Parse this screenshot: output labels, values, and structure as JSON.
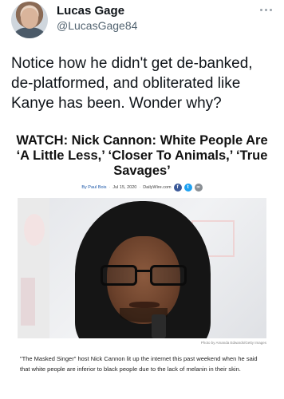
{
  "tweet": {
    "user_name": "Lucas Gage",
    "user_handle": "@LucasGage84",
    "text": "Notice how he didn't get de-banked, de-platformed, and obliterated like Kanye has been. Wonder why?"
  },
  "article": {
    "headline": "WATCH: Nick Cannon: White People Are ‘A Little Less,’ ‘Closer To Animals,’ ‘True Savages’",
    "byline": "By Paul Bois",
    "date": "Jul 15, 2020",
    "source": "DailyWire.com",
    "share_icons": [
      "facebook-icon",
      "twitter-icon",
      "link-icon"
    ],
    "photo_credit": "Photo by Amanda Edwards/Getty Images",
    "body": "\"The Masked Singer\" host Nick Cannon lit up the internet this past weekend when he said that white people are inferior to black people due to the lack of melanin in their skin."
  },
  "colors": {
    "handle": "#536471",
    "facebook": "#3b5998",
    "twitter": "#1da1f2",
    "link": "#8a8f94"
  }
}
